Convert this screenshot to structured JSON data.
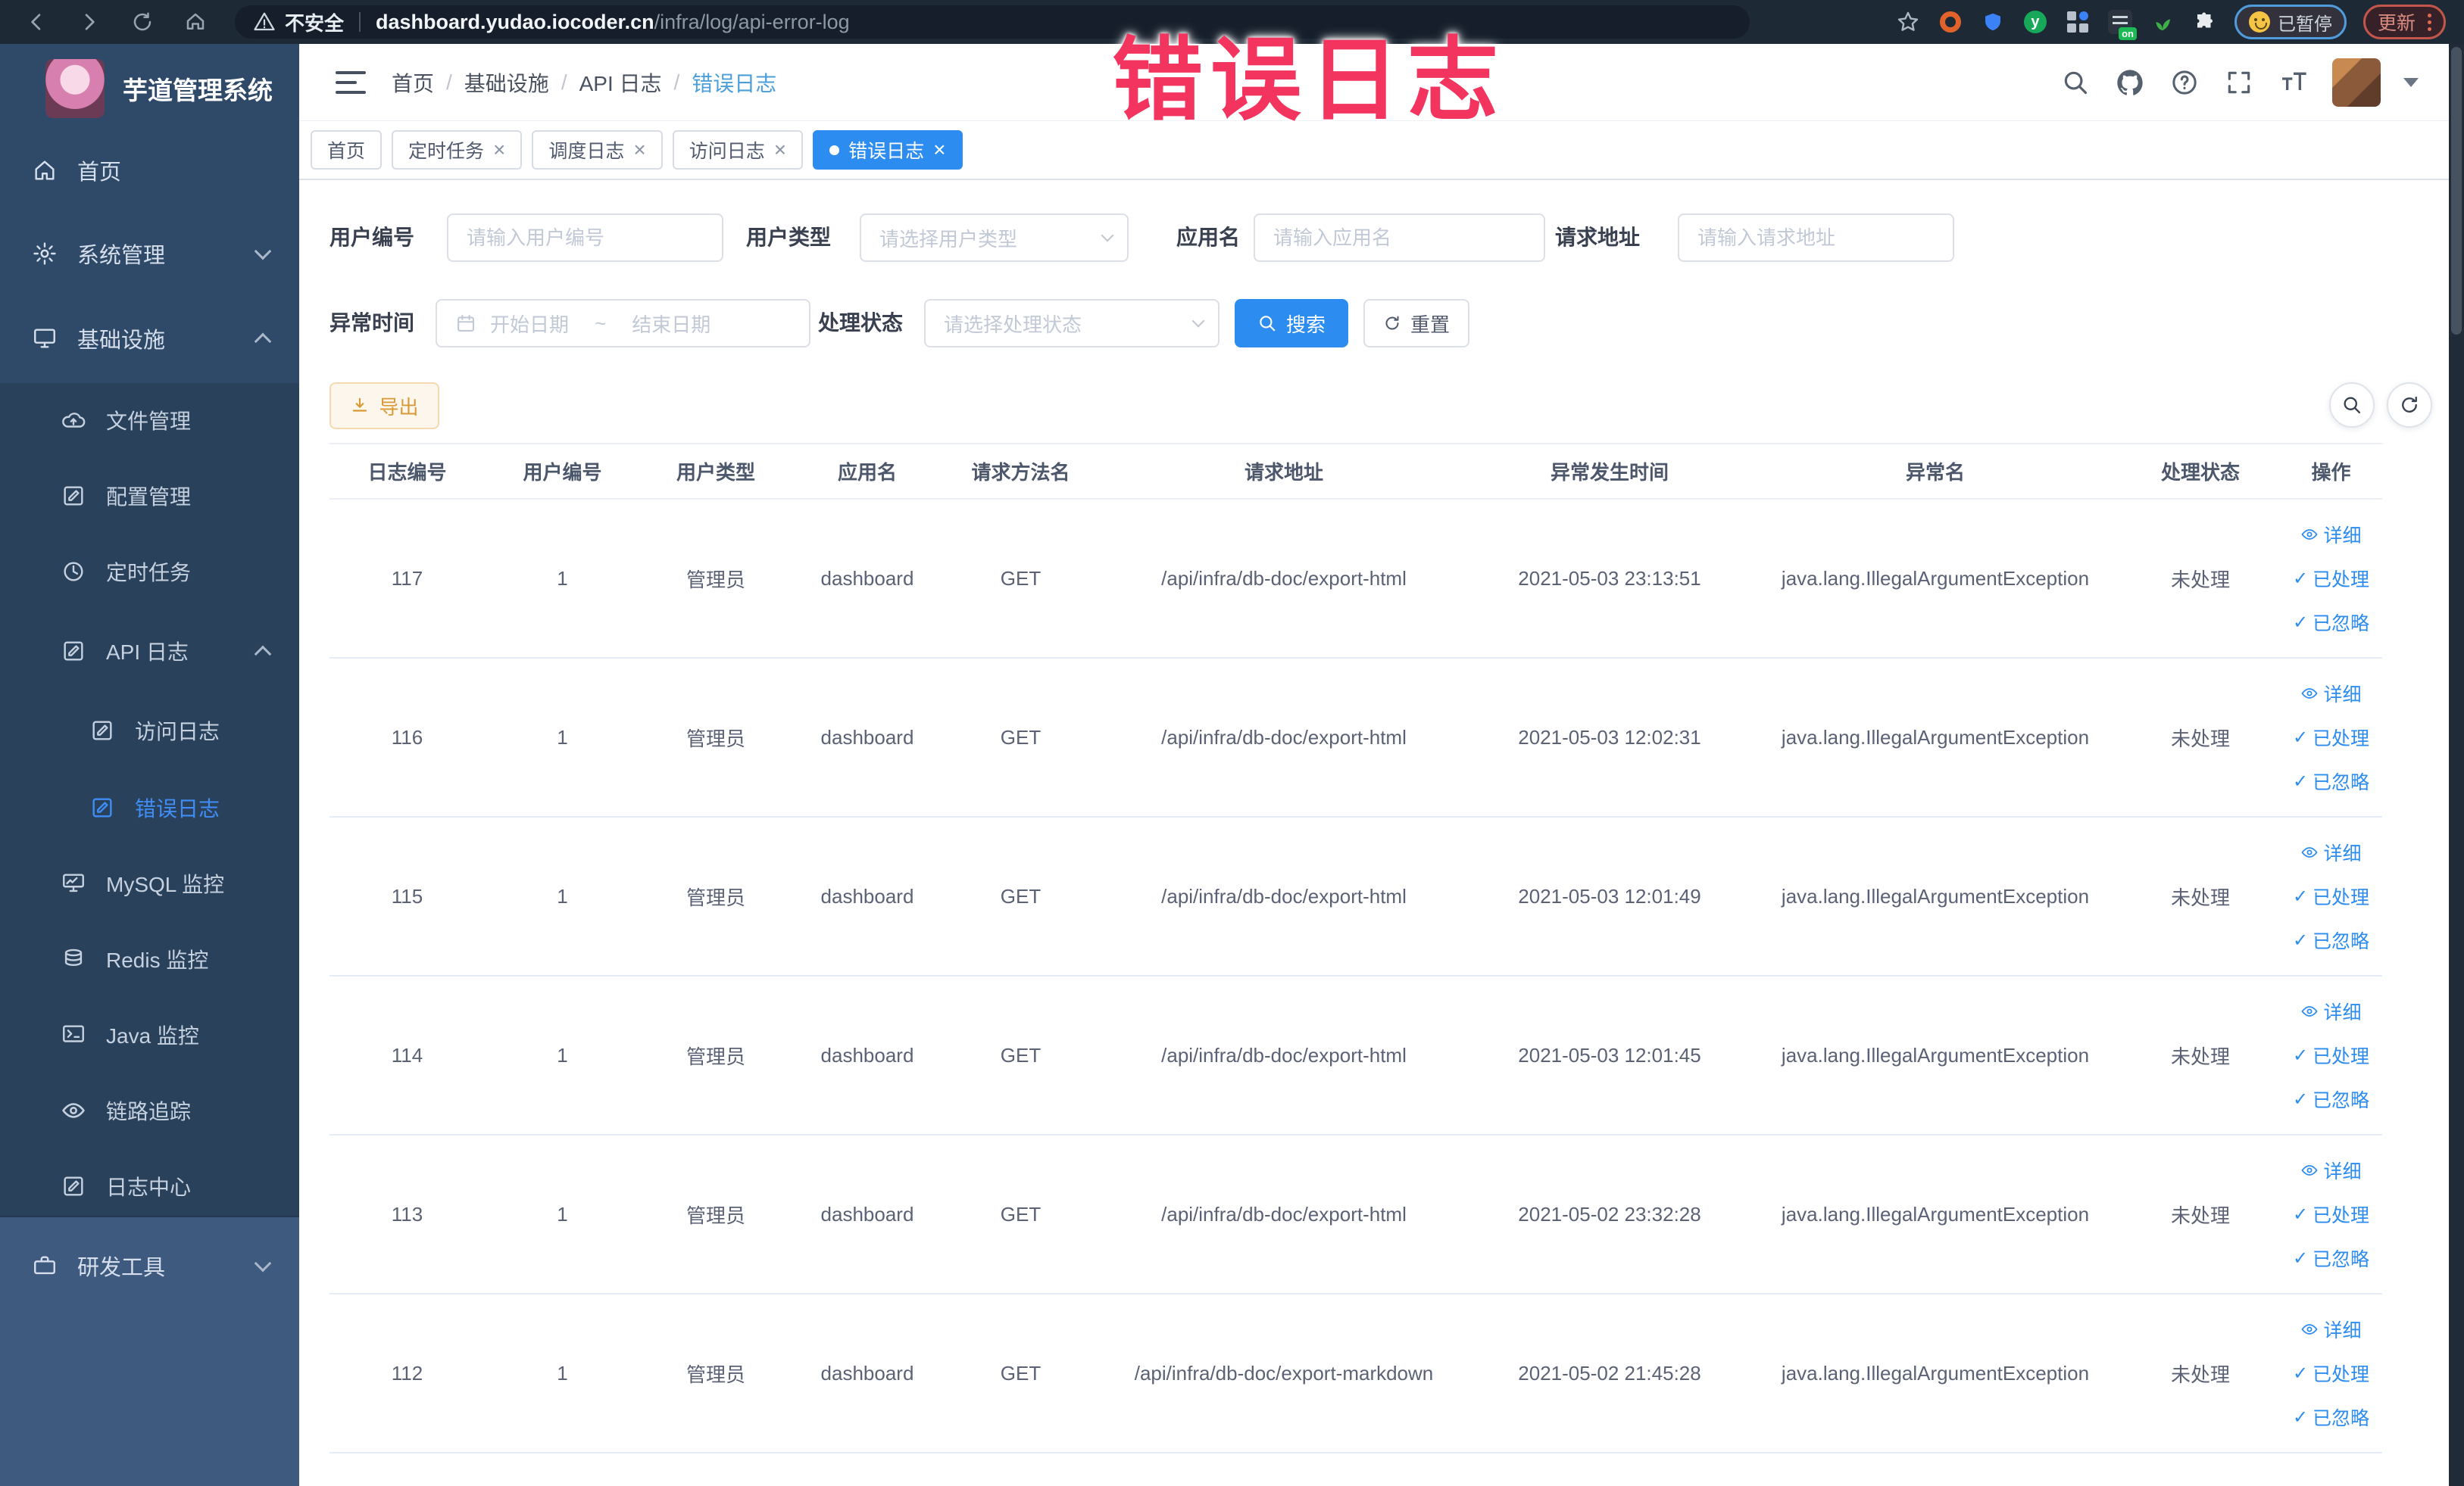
{
  "annotation": {
    "title": "错误日志"
  },
  "browser": {
    "security": "不安全",
    "domain": "dashboard.yudao.iocoder.cn",
    "path": "/infra/log/api-error-log",
    "ext_y": "y",
    "ext_on": "on",
    "paused": "已暂停",
    "update": "更新"
  },
  "sidebar": {
    "title": "芋道管理系统",
    "items": [
      {
        "label": "首页"
      },
      {
        "label": "系统管理"
      },
      {
        "label": "基础设施"
      },
      {
        "label": "文件管理"
      },
      {
        "label": "配置管理"
      },
      {
        "label": "定时任务"
      },
      {
        "label": "API 日志"
      },
      {
        "label": "访问日志"
      },
      {
        "label": "错误日志"
      },
      {
        "label": "MySQL 监控"
      },
      {
        "label": "Redis 监控"
      },
      {
        "label": "Java 监控"
      },
      {
        "label": "链路追踪"
      },
      {
        "label": "日志中心"
      },
      {
        "label": "研发工具"
      }
    ]
  },
  "header": {
    "breadcrumb": [
      "首页",
      "基础设施",
      "API 日志",
      "错误日志"
    ]
  },
  "tabs": [
    {
      "label": "首页"
    },
    {
      "label": "定时任务"
    },
    {
      "label": "调度日志"
    },
    {
      "label": "访问日志"
    },
    {
      "label": "错误日志"
    }
  ],
  "filters": {
    "user_id": {
      "label": "用户编号",
      "placeholder": "请输入用户编号"
    },
    "user_type": {
      "label": "用户类型",
      "placeholder": "请选择用户类型"
    },
    "app_name": {
      "label": "应用名",
      "placeholder": "请输入应用名"
    },
    "request_url": {
      "label": "请求地址",
      "placeholder": "请输入请求地址"
    },
    "exception_time": {
      "label": "异常时间",
      "start_placeholder": "开始日期",
      "separator": "~",
      "end_placeholder": "结束日期"
    },
    "process_status": {
      "label": "处理状态",
      "placeholder": "请选择处理状态"
    },
    "search": "搜索",
    "reset": "重置",
    "export": "导出"
  },
  "table": {
    "columns": [
      "日志编号",
      "用户编号",
      "用户类型",
      "应用名",
      "请求方法名",
      "请求地址",
      "异常发生时间",
      "异常名",
      "处理状态",
      "操作"
    ],
    "actions": {
      "detail": "详细",
      "processed": "已处理",
      "ignored": "已忽略"
    },
    "rows": [
      {
        "id": "117",
        "user_id": "1",
        "user_type": "管理员",
        "app": "dashboard",
        "method": "GET",
        "url": "/api/infra/db-doc/export-html",
        "time": "2021-05-03 23:13:51",
        "exception": "java.lang.IllegalArgumentException",
        "status": "未处理"
      },
      {
        "id": "116",
        "user_id": "1",
        "user_type": "管理员",
        "app": "dashboard",
        "method": "GET",
        "url": "/api/infra/db-doc/export-html",
        "time": "2021-05-03 12:02:31",
        "exception": "java.lang.IllegalArgumentException",
        "status": "未处理"
      },
      {
        "id": "115",
        "user_id": "1",
        "user_type": "管理员",
        "app": "dashboard",
        "method": "GET",
        "url": "/api/infra/db-doc/export-html",
        "time": "2021-05-03 12:01:49",
        "exception": "java.lang.IllegalArgumentException",
        "status": "未处理"
      },
      {
        "id": "114",
        "user_id": "1",
        "user_type": "管理员",
        "app": "dashboard",
        "method": "GET",
        "url": "/api/infra/db-doc/export-html",
        "time": "2021-05-03 12:01:45",
        "exception": "java.lang.IllegalArgumentException",
        "status": "未处理"
      },
      {
        "id": "113",
        "user_id": "1",
        "user_type": "管理员",
        "app": "dashboard",
        "method": "GET",
        "url": "/api/infra/db-doc/export-html",
        "time": "2021-05-02 23:32:28",
        "exception": "java.lang.IllegalArgumentException",
        "status": "未处理"
      },
      {
        "id": "112",
        "user_id": "1",
        "user_type": "管理员",
        "app": "dashboard",
        "method": "GET",
        "url": "/api/infra/db-doc/export-markdown",
        "time": "2021-05-02 21:45:28",
        "exception": "java.lang.IllegalArgumentException",
        "status": "未处理"
      }
    ]
  }
}
